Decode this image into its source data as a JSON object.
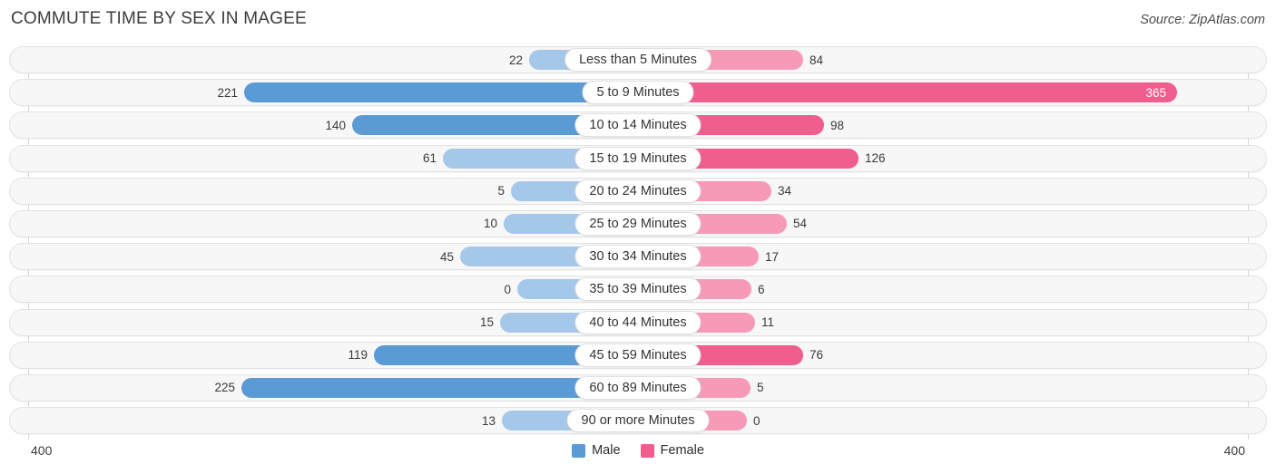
{
  "header": {
    "title": "COMMUTE TIME BY SEX IN MAGEE",
    "source": "Source: ZipAtlas.com"
  },
  "axis": {
    "left_max_label": "400",
    "right_max_label": "400"
  },
  "legend": {
    "items": [
      {
        "label": "Male",
        "color": "#5b9bd5"
      },
      {
        "label": "Female",
        "color": "#ef5e8d"
      }
    ]
  },
  "colors": {
    "male_strong": "#5b9bd5",
    "male_light": "#a5c8ea",
    "female_strong": "#ef5e8d",
    "female_light": "#f79ab8",
    "track_fill": "#f7f7f7",
    "track_border": "#e3e3e3",
    "gridline": "#d6d6d6",
    "title_text": "#3c3c3c"
  },
  "chart_data": {
    "type": "bar",
    "subtype": "diverging-population-pyramid",
    "title": "COMMUTE TIME BY SEX IN MAGEE",
    "xlabel": "",
    "ylabel": "",
    "xlim": [
      400,
      400
    ],
    "axis_max": 400,
    "grid": true,
    "legend_position": "bottom-center",
    "categories": [
      "Less than 5 Minutes",
      "5 to 9 Minutes",
      "10 to 14 Minutes",
      "15 to 19 Minutes",
      "20 to 24 Minutes",
      "25 to 29 Minutes",
      "30 to 34 Minutes",
      "35 to 39 Minutes",
      "40 to 44 Minutes",
      "45 to 59 Minutes",
      "60 to 89 Minutes",
      "90 or more Minutes"
    ],
    "series": [
      {
        "name": "Male",
        "direction": "left",
        "values": [
          22,
          221,
          140,
          61,
          5,
          10,
          45,
          0,
          15,
          119,
          225,
          13
        ]
      },
      {
        "name": "Female",
        "direction": "right",
        "values": [
          84,
          365,
          98,
          126,
          34,
          54,
          17,
          6,
          11,
          76,
          5,
          0
        ]
      }
    ]
  },
  "rows": [
    {
      "label": "Less than 5 Minutes",
      "male": "22",
      "female": "84",
      "male_w": 120,
      "female_w": 182,
      "male_tone": "light",
      "female_tone": "light",
      "female_inside": false,
      "male_inside": false
    },
    {
      "label": "5 to 9 Minutes",
      "male": "221",
      "female": "365",
      "male_w": 434,
      "female_w": 594,
      "male_tone": "strong",
      "female_tone": "strong",
      "female_inside": true,
      "male_inside": false
    },
    {
      "label": "10 to 14 Minutes",
      "male": "140",
      "female": "98",
      "male_w": 315,
      "female_w": 205,
      "male_tone": "strong",
      "female_tone": "strong",
      "female_inside": false,
      "male_inside": false
    },
    {
      "label": "15 to 19 Minutes",
      "male": "61",
      "female": "126",
      "male_w": 215,
      "female_w": 243,
      "male_tone": "light",
      "female_tone": "strong",
      "female_inside": false,
      "male_inside": false
    },
    {
      "label": "20 to 24 Minutes",
      "male": "5",
      "female": "34",
      "male_w": 140,
      "female_w": 147,
      "male_tone": "light",
      "female_tone": "light",
      "female_inside": false,
      "male_inside": false
    },
    {
      "label": "25 to 29 Minutes",
      "male": "10",
      "female": "54",
      "male_w": 148,
      "female_w": 164,
      "male_tone": "light",
      "female_tone": "light",
      "female_inside": false,
      "male_inside": false
    },
    {
      "label": "30 to 34 Minutes",
      "male": "45",
      "female": "17",
      "male_w": 196,
      "female_w": 133,
      "male_tone": "light",
      "female_tone": "light",
      "female_inside": false,
      "male_inside": false
    },
    {
      "label": "35 to 39 Minutes",
      "male": "0",
      "female": "6",
      "male_w": 133,
      "female_w": 125,
      "male_tone": "light",
      "female_tone": "light",
      "female_inside": false,
      "male_inside": false
    },
    {
      "label": "40 to 44 Minutes",
      "male": "15",
      "female": "11",
      "male_w": 152,
      "female_w": 129,
      "male_tone": "light",
      "female_tone": "light",
      "female_inside": false,
      "male_inside": false
    },
    {
      "label": "45 to 59 Minutes",
      "male": "119",
      "female": "76",
      "male_w": 291,
      "female_w": 182,
      "male_tone": "strong",
      "female_tone": "strong",
      "female_inside": false,
      "male_inside": false
    },
    {
      "label": "60 to 89 Minutes",
      "male": "225",
      "female": "5",
      "male_w": 437,
      "female_w": 124,
      "male_tone": "strong",
      "female_tone": "light",
      "female_inside": false,
      "male_inside": false
    },
    {
      "label": "90 or more Minutes",
      "male": "13",
      "female": "0",
      "male_w": 150,
      "female_w": 120,
      "male_tone": "light",
      "female_tone": "light",
      "female_inside": false,
      "male_inside": false
    }
  ]
}
